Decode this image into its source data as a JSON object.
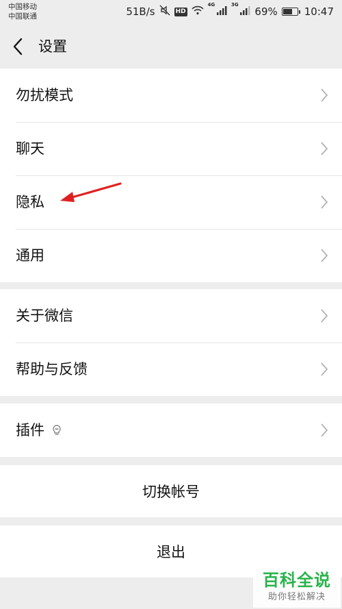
{
  "status_bar": {
    "carrier_1": "中国移动",
    "carrier_2": "中国联通",
    "speed": "51B/s",
    "hd": "HD",
    "net_1": "4G",
    "net_2": "3G",
    "battery_text": "69%",
    "battery_level": 0.69,
    "time": "10:47"
  },
  "header": {
    "title": "设置"
  },
  "groups": [
    {
      "items": [
        {
          "label": "勿扰模式"
        },
        {
          "label": "聊天"
        },
        {
          "label": "隐私"
        },
        {
          "label": "通用"
        }
      ]
    },
    {
      "items": [
        {
          "label": "关于微信"
        },
        {
          "label": "帮助与反馈"
        }
      ]
    },
    {
      "items": [
        {
          "label": "插件"
        }
      ]
    }
  ],
  "actions": {
    "switch_account": "切换帐号",
    "logout": "退出"
  },
  "watermark": {
    "line1": "百科全说",
    "line2": "助你轻松解决"
  },
  "colors": {
    "background": "#ededed",
    "annotation": "#e02020",
    "watermark_green": "#29b34b"
  }
}
